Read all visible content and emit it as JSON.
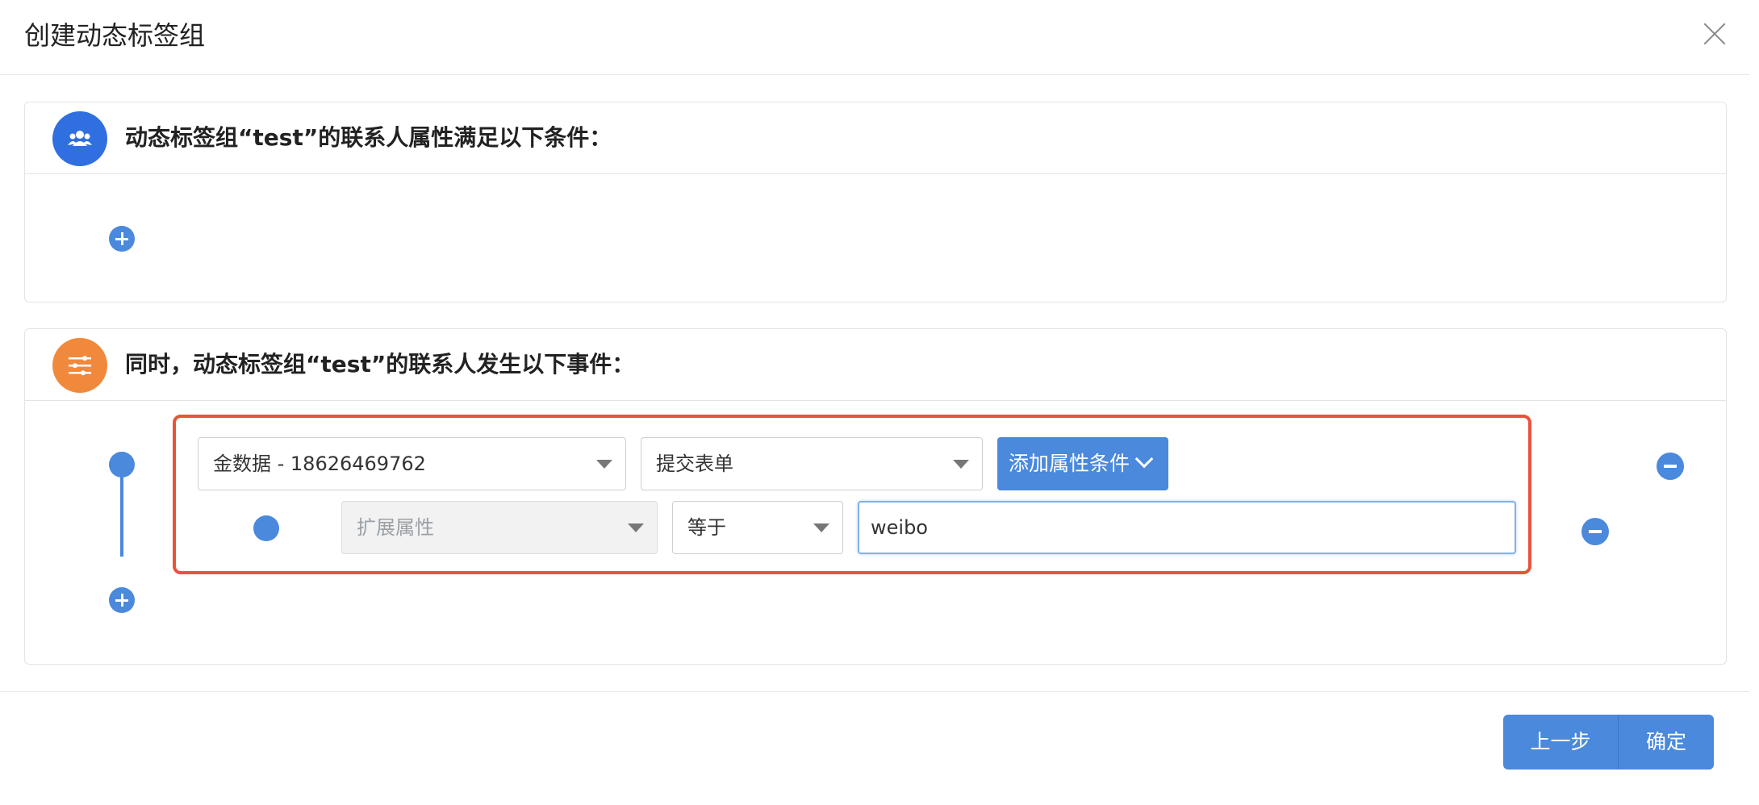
{
  "dialog": {
    "title": "创建动态标签组"
  },
  "attribute_section": {
    "title": "动态标签组“test”的联系人属性满足以下条件：",
    "icon": "users-icon"
  },
  "event_section": {
    "title": "同时，动态标签组“test”的联系人发生以下事件：",
    "icon": "sliders-icon",
    "event_row": {
      "source_select": "金数据 - 18626469762",
      "event_select": "提交表单",
      "add_condition_label": "添加属性条件"
    },
    "condition_row": {
      "attribute_select": "扩展属性",
      "operator_select": "等于",
      "value_input": "weibo"
    }
  },
  "footer": {
    "prev_label": "上一步",
    "ok_label": "确定"
  },
  "colors": {
    "accent": "#4a89dc",
    "highlight_border": "#e9533a",
    "icon_blue": "#2f6fe0",
    "icon_orange": "#f0893c"
  }
}
